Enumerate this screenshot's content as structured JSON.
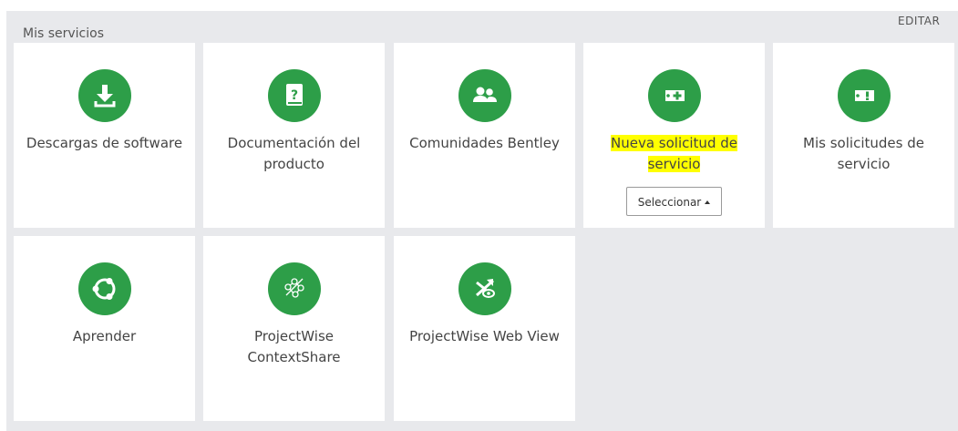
{
  "section": {
    "title": "Mis servicios",
    "edit_label": "EDITAR"
  },
  "cards": [
    {
      "label": "Descargas de software",
      "icon": "download-icon"
    },
    {
      "label_line1": "Documentación del",
      "label_line2": "producto",
      "icon": "book-question-icon"
    },
    {
      "label": "Comunidades Bentley",
      "icon": "users-icon"
    },
    {
      "label_line1": "Nueva solicitud de",
      "label_line2": "servicio",
      "icon": "ticket-plus-icon",
      "button_label": "Seleccionar"
    },
    {
      "label_line1": "Mis solicitudes de",
      "label_line2": "servicio",
      "icon": "ticket-alert-icon"
    },
    {
      "label": "Aprender",
      "icon": "learn-icon"
    },
    {
      "label_line1": "ProjectWise",
      "label_line2": "ContextShare",
      "icon": "contextshare-icon"
    },
    {
      "label": "ProjectWise Web View",
      "icon": "webview-icon"
    }
  ],
  "colors": {
    "accent": "#2d9e48",
    "panel_bg": "#e8e9ec",
    "highlight": "#ffff00"
  }
}
